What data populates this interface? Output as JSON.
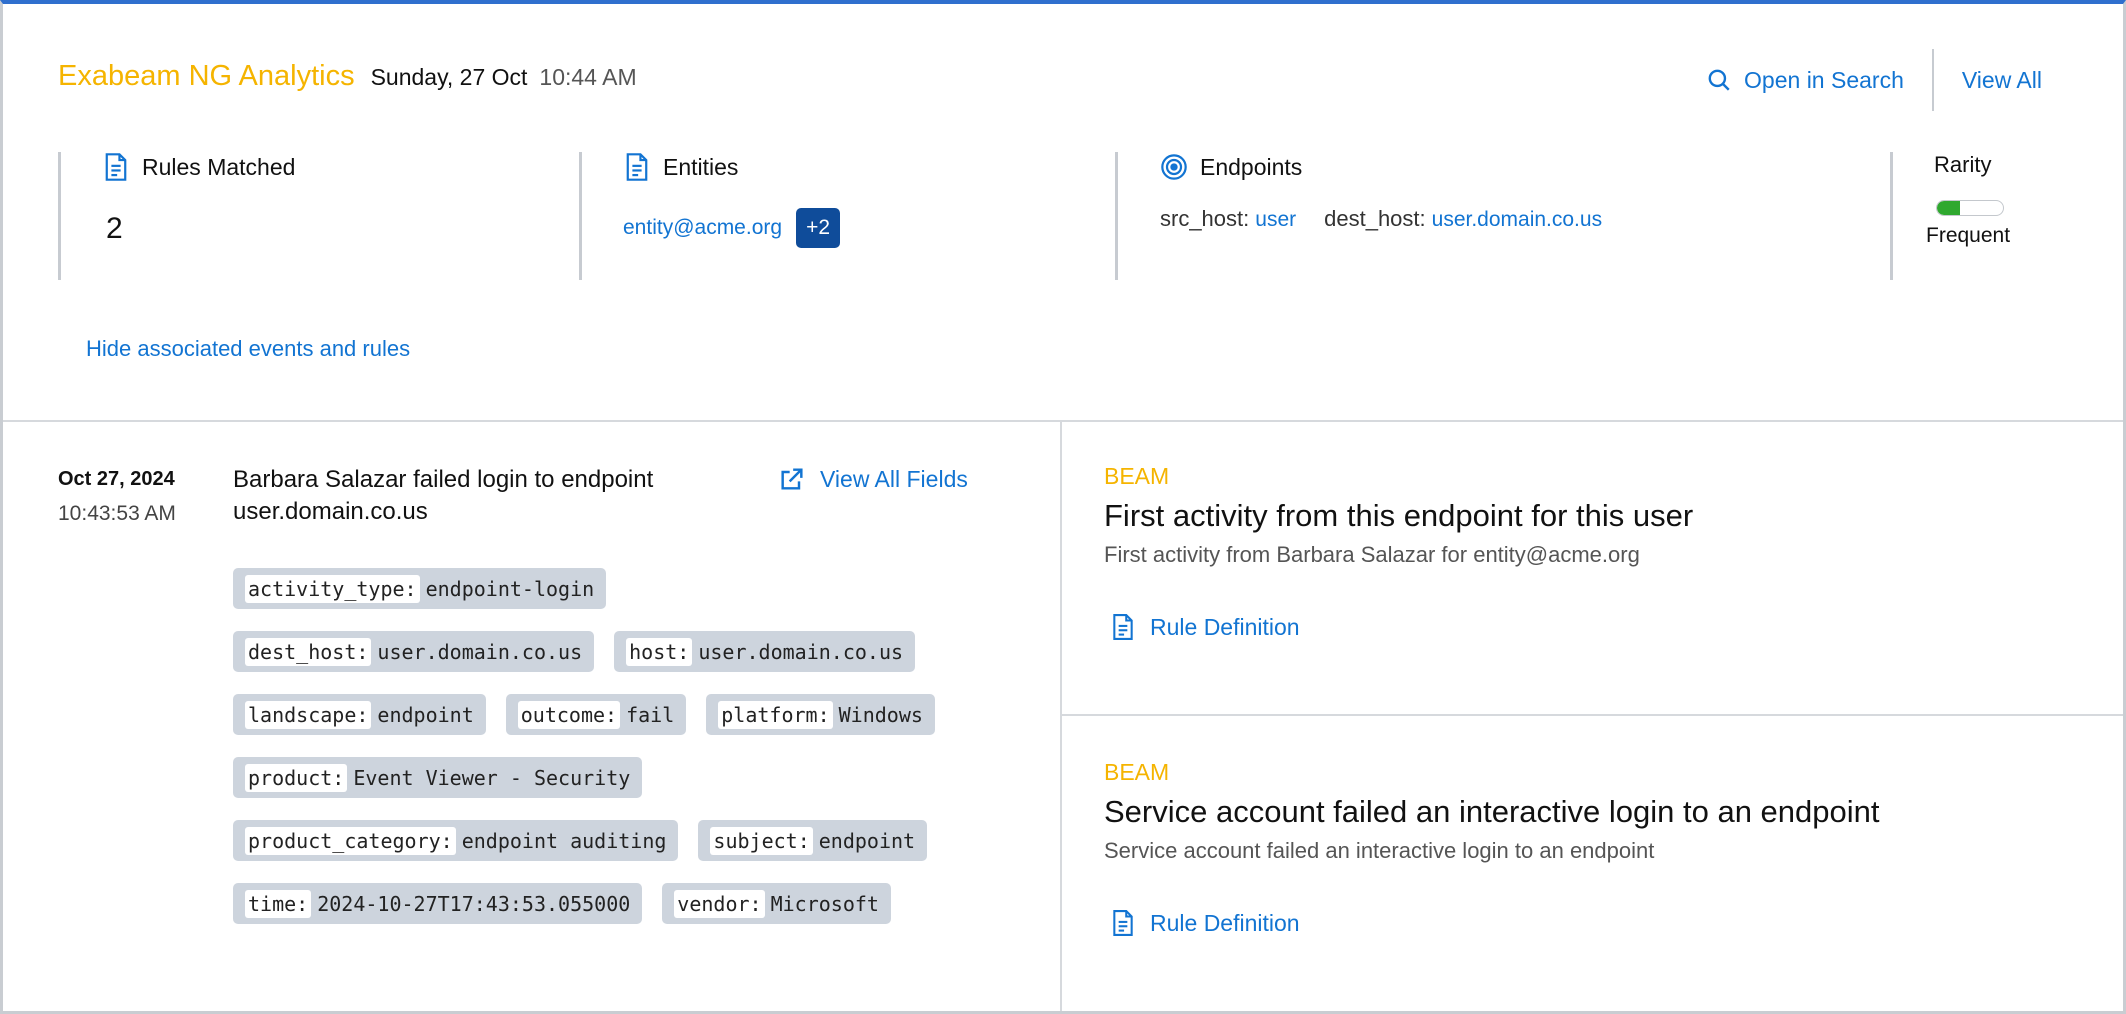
{
  "header": {
    "app_name": "Exabeam NG Analytics",
    "date": "Sunday, 27 Oct",
    "time": "10:44 AM",
    "open_in_search": "Open in Search",
    "view_all": "View All"
  },
  "summary": {
    "rules_matched": {
      "title": "Rules Matched",
      "value": "2"
    },
    "entities": {
      "title": "Entities",
      "primary": "entity@acme.org",
      "extra": "+2"
    },
    "endpoints": {
      "title": "Endpoints",
      "src_key": "src_host:",
      "src_val": "user",
      "dest_key": "dest_host:",
      "dest_val": "user.domain.co.us"
    },
    "rarity": {
      "title": "Rarity",
      "label": "Frequent",
      "level": 0.35,
      "color": "#2fa82f"
    }
  },
  "toggle_label": "Hide associated events and rules",
  "event": {
    "date": "Oct 27, 2024",
    "time": "10:43:53 AM",
    "title": "Barbara Salazar failed login to endpoint user.domain.co.us",
    "view_all_fields": "View All Fields",
    "tags": [
      [
        {
          "k": "activity_type:",
          "v": "endpoint-login"
        }
      ],
      [
        {
          "k": "dest_host:",
          "v": "user.domain.co.us"
        },
        {
          "k": "host:",
          "v": "user.domain.co.us"
        }
      ],
      [
        {
          "k": "landscape:",
          "v": "endpoint"
        },
        {
          "k": "outcome:",
          "v": "fail"
        },
        {
          "k": "platform:",
          "v": "Windows"
        }
      ],
      [
        {
          "k": "product:",
          "v": "Event Viewer - Security"
        }
      ],
      [
        {
          "k": "product_category:",
          "v": "endpoint auditing"
        },
        {
          "k": "subject:",
          "v": "endpoint"
        }
      ],
      [
        {
          "k": "time:",
          "v": "2024-10-27T17:43:53.055000"
        },
        {
          "k": "vendor:",
          "v": "Microsoft"
        }
      ]
    ]
  },
  "rules": [
    {
      "source": "BEAM",
      "name": "First activity from this endpoint for this user",
      "description": "First activity from Barbara Salazar for entity@acme.org",
      "definition_label": "Rule Definition"
    },
    {
      "source": "BEAM",
      "name": "Service account failed an interactive login to an endpoint",
      "description": "Service account failed an interactive login to an endpoint",
      "definition_label": "Rule Definition"
    }
  ],
  "colors": {
    "accent": "#1274d2",
    "brand": "#f5b400",
    "badge": "#0f4c9a"
  },
  "icons": {
    "open_in_search": "search-icon",
    "rules_matched": "document-icon",
    "entities": "document-icon",
    "endpoints": "target-icon",
    "view_all_fields": "external-link-icon",
    "rule_definition": "document-icon"
  }
}
